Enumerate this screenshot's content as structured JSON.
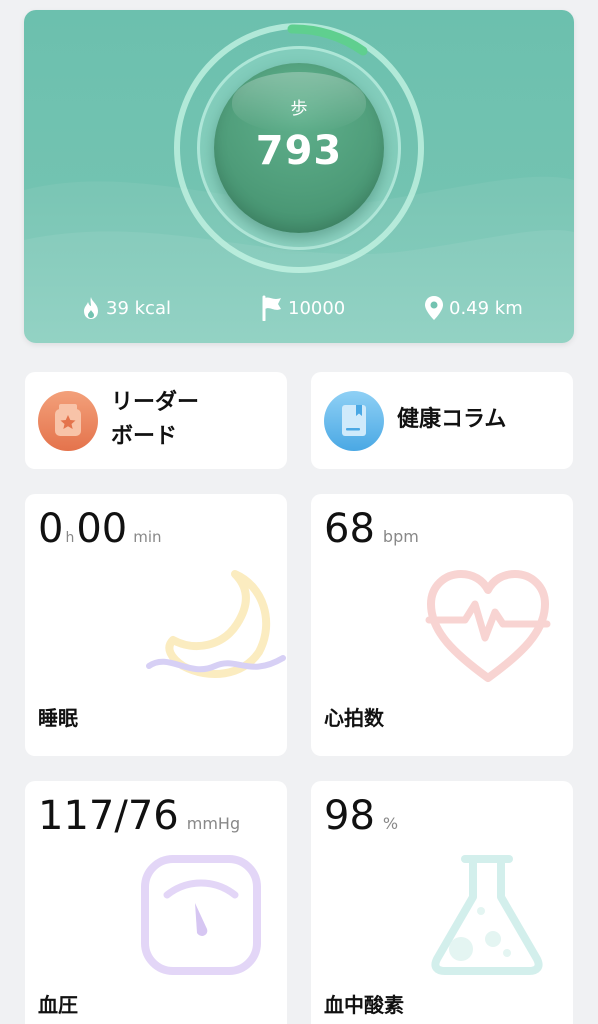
{
  "activity": {
    "steps_unit": "歩",
    "steps_value": "793",
    "goal_progress": 0.07,
    "calories": "39 kcal",
    "goal": "10000",
    "distance": "0.49 km"
  },
  "shortcuts": {
    "leaderboard": {
      "label_line1": "リーダー",
      "label_line2": "ボード"
    },
    "health_column": {
      "label": "健康コラム"
    }
  },
  "metrics": {
    "sleep": {
      "hours": "0",
      "hours_unit": "h",
      "minutes": "00",
      "minutes_unit": "min",
      "title": "睡眠"
    },
    "heart_rate": {
      "value": "68",
      "unit": "bpm",
      "title": "心拍数"
    },
    "blood_pressure": {
      "value": "117/76",
      "unit": "mmHg",
      "title": "血圧"
    },
    "blood_oxygen": {
      "value": "98",
      "unit": "%",
      "title": "血中酸素"
    }
  },
  "colors": {
    "hero_bg": "#6cc0ae",
    "progress_arc": "#5fcf8f",
    "card_bg": "#ffffff",
    "page_bg": "#f0f1f3"
  },
  "icons": {
    "calories": "flame-icon",
    "goal": "flag-icon",
    "distance": "location-pin-icon",
    "leaderboard": "trophy-badge-icon",
    "health_column": "book-icon",
    "sleep": "moon-icon",
    "heart_rate": "heart-pulse-icon",
    "blood_pressure": "gauge-icon",
    "blood_oxygen": "flask-icon"
  }
}
